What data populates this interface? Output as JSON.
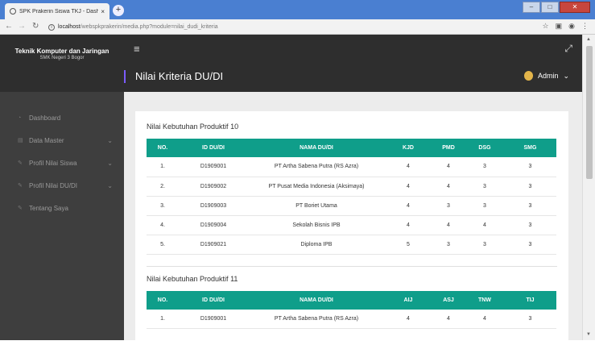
{
  "browser": {
    "tab_title": "SPK Prakerin Siswa TKJ - Dashbo...",
    "tab_close": "×",
    "new_tab": "+",
    "url_host": "localhost",
    "url_path": "/webspkprakerin/media.php?module=nilai_dudi_kriteria",
    "win_min": "–",
    "win_max": "□",
    "win_close": "✕"
  },
  "sidebar": {
    "brand_title": "Teknik Komputer dan Jaringan",
    "brand_sub": "SMK Negeri 3 Bogor",
    "items": [
      {
        "label": "Dashboard",
        "icon": "dashboard-icon",
        "glyph": "◔",
        "chev": ""
      },
      {
        "label": "Data Master",
        "icon": "folder-icon",
        "glyph": "▤",
        "chev": "⌄"
      },
      {
        "label": "Profil Nilai Siswa",
        "icon": "pencil-icon",
        "glyph": "✎",
        "chev": "⌄"
      },
      {
        "label": "Profil Nilai DU/DI",
        "icon": "pencil-icon",
        "glyph": "✎",
        "chev": "⌄"
      },
      {
        "label": "Tentang Saya",
        "icon": "pencil-icon",
        "glyph": "✎",
        "chev": ""
      }
    ]
  },
  "header": {
    "title": "Nilai Kriteria DU/DI",
    "user": "Admin",
    "user_chev": "⌄"
  },
  "section1": {
    "title": "Nilai Kebutuhan Produktif 10",
    "columns": [
      "NO.",
      "ID DU/DI",
      "NAMA DU/DI",
      "KJD",
      "PMD",
      "DSG",
      "SMG"
    ],
    "rows": [
      [
        "1.",
        "D1909001",
        "PT Artha Sabena Putra (RS Azra)",
        "4",
        "4",
        "3",
        "3"
      ],
      [
        "2.",
        "D1909002",
        "PT Pusat Media Indonesia (Aksimaya)",
        "4",
        "4",
        "3",
        "3"
      ],
      [
        "3.",
        "D1909003",
        "PT Boriet Utama",
        "4",
        "3",
        "3",
        "3"
      ],
      [
        "4.",
        "D1909004",
        "Sekolah Bisnis IPB",
        "4",
        "4",
        "4",
        "3"
      ],
      [
        "5.",
        "D1909021",
        "Diploma IPB",
        "5",
        "3",
        "3",
        "3"
      ]
    ]
  },
  "section2": {
    "title": "Nilai Kebutuhan Produktif 11",
    "columns": [
      "NO.",
      "ID DU/DI",
      "NAMA DU/DI",
      "AIJ",
      "ASJ",
      "TNW",
      "TIJ"
    ],
    "rows": [
      [
        "1.",
        "D1909001",
        "PT Artha Sabena Putra (RS Azra)",
        "4",
        "4",
        "4",
        "3"
      ]
    ]
  }
}
